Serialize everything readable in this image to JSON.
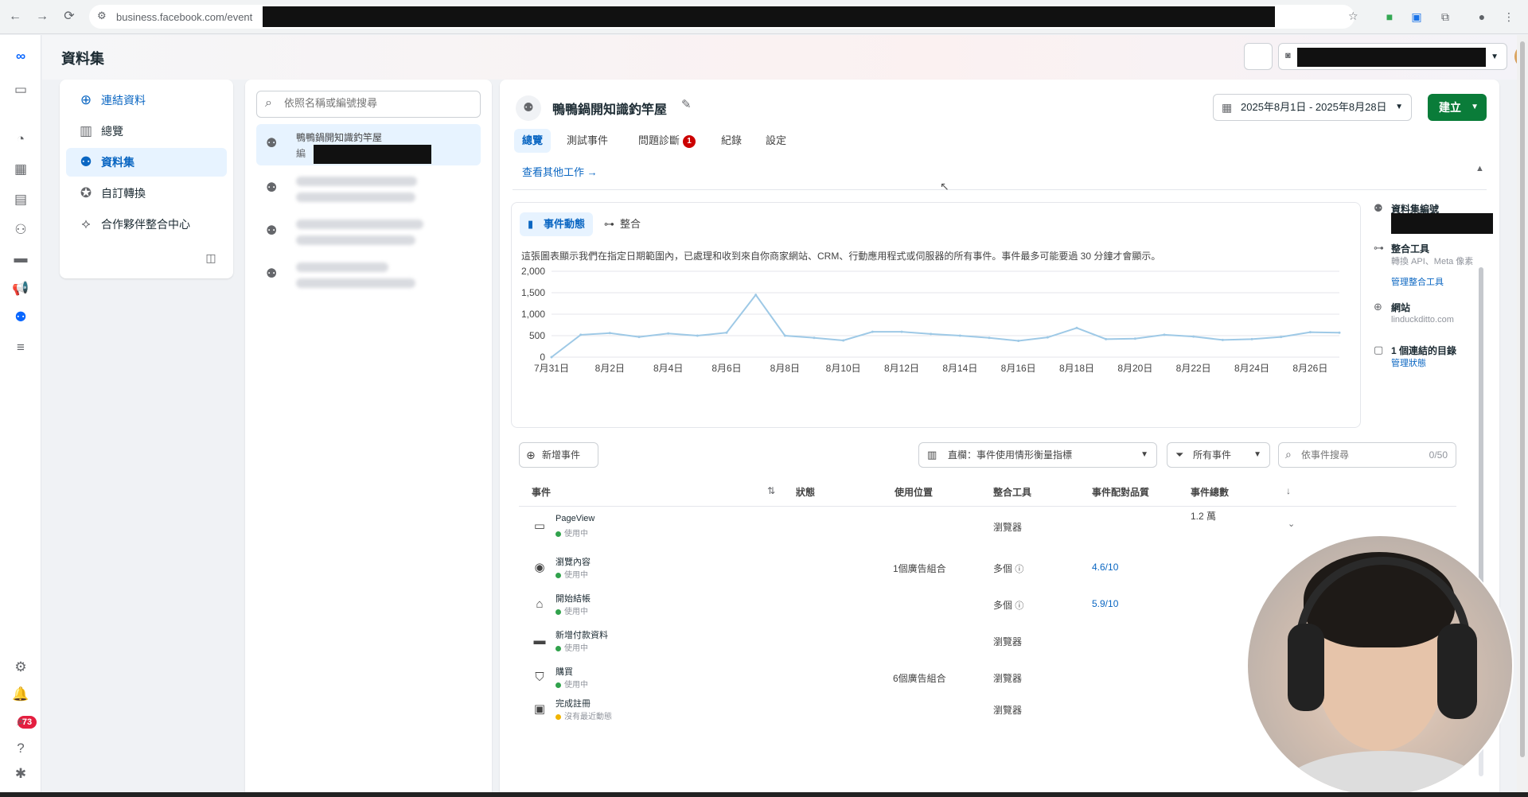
{
  "browser": {
    "url": "business.facebook.com/event"
  },
  "app": {
    "page_title": "資料集",
    "notification_count": "73"
  },
  "nav": {
    "items": [
      {
        "label": "連結資料",
        "icon": "plus-circle-icon"
      },
      {
        "label": "總覽",
        "icon": "layout-icon"
      },
      {
        "label": "資料集",
        "icon": "dataset-icon"
      },
      {
        "label": "自訂轉換",
        "icon": "star-badge-icon"
      },
      {
        "label": "合作夥伴整合中心",
        "icon": "handshake-icon"
      }
    ],
    "active_index": 2
  },
  "dataset_list": {
    "search_placeholder": "依照名稱或編號搜尋",
    "selected": {
      "name": "鴨鴨鍋開知識釣竿屋",
      "sub": "編"
    }
  },
  "dataset": {
    "title": "鴨鴨鍋開知識釣竿屋",
    "date_range": "2025年8月1日 - 2025年8月28日",
    "create_label": "建立",
    "tabs": [
      "總覽",
      "測試事件",
      "問題診斷",
      "紀錄",
      "設定"
    ],
    "diagnostics_badge": "1",
    "other_tasks_link": "查看其他工作 →"
  },
  "chart_panel": {
    "tabs": [
      "事件動態",
      "整合"
    ],
    "description": "這張圖表顯示我們在指定日期範圍內，已處理和收到來自你商家網站、CRM、行動應用程式或伺服器的所有事件。事件最多可能要過 30 分鐘才會顯示。"
  },
  "chart_data": {
    "type": "line",
    "x": [
      "7月31日",
      "8月1日",
      "8月2日",
      "8月3日",
      "8月4日",
      "8月5日",
      "8月6日",
      "8月7日",
      "8月8日",
      "8月9日",
      "8月10日",
      "8月11日",
      "8月12日",
      "8月13日",
      "8月14日",
      "8月15日",
      "8月16日",
      "8月17日",
      "8月18日",
      "8月19日",
      "8月20日",
      "8月21日",
      "8月22日",
      "8月23日",
      "8月24日",
      "8月25日",
      "8月26日",
      "8月27日"
    ],
    "tick_labels": [
      "7月31日",
      "8月2日",
      "8月4日",
      "8月6日",
      "8月8日",
      "8月10日",
      "8月12日",
      "8月14日",
      "8月16日",
      "8月18日",
      "8月20日",
      "8月22日",
      "8月24日",
      "8月26日"
    ],
    "values": [
      0,
      520,
      560,
      470,
      550,
      500,
      570,
      1450,
      500,
      450,
      390,
      590,
      590,
      540,
      500,
      450,
      380,
      460,
      680,
      420,
      430,
      520,
      480,
      400,
      420,
      470,
      580,
      570
    ],
    "yticks": [
      "0",
      "500",
      "1,000",
      "1,500",
      "2,000"
    ],
    "ylim": [
      0,
      2000
    ],
    "grid": true,
    "color": "#9ec9e6"
  },
  "info": {
    "dataset_id_label": "資料集編號",
    "integration_label": "整合工具",
    "integration_sub": "轉換 API、Meta 像素",
    "integration_link": "管理整合工具",
    "website_label": "網站",
    "website_value": "linduckditto.com",
    "catalog_label": "1 個連結的目錄",
    "catalog_link": "管理狀態"
  },
  "events_toolbar": {
    "add_label": "新增事件",
    "columns_label": "直欄：事件使用情形衡量指標",
    "filter_label": "所有事件",
    "search_placeholder": "依事件搜尋",
    "count": "0/50"
  },
  "events_table": {
    "headers": [
      "事件",
      "狀態",
      "使用位置",
      "整合工具",
      "事件配對品質",
      "事件總數"
    ],
    "rows": [
      {
        "icon": "page-icon",
        "name": "PageView",
        "status": "使用中",
        "status_color": "#31a24c",
        "place": "",
        "integration": "瀏覽器",
        "quality": "",
        "total": "1.2 萬"
      },
      {
        "icon": "eye-icon",
        "name": "瀏覽內容",
        "status": "使用中",
        "status_color": "#31a24c",
        "place": "1個廣告組合",
        "integration": "多個",
        "quality": "4.6/10",
        "total": ""
      },
      {
        "icon": "basket-icon",
        "name": "開始結帳",
        "status": "使用中",
        "status_color": "#31a24c",
        "place": "",
        "integration": "多個",
        "quality": "5.9/10",
        "total": ""
      },
      {
        "icon": "card-icon",
        "name": "新增付款資料",
        "status": "使用中",
        "status_color": "#31a24c",
        "place": "",
        "integration": "瀏覽器",
        "quality": "",
        "total": ""
      },
      {
        "icon": "bag-icon",
        "name": "購買",
        "status": "使用中",
        "status_color": "#31a24c",
        "place": "6個廣告組合",
        "integration": "瀏覽器",
        "quality": "",
        "total": ""
      },
      {
        "icon": "register-icon",
        "name": "完成註冊",
        "status": "沒有最近動態",
        "status_color": "#f0b400",
        "place": "",
        "integration": "瀏覽器",
        "quality": "",
        "total": ""
      }
    ]
  }
}
